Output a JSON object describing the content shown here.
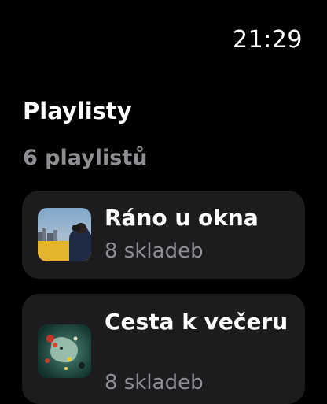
{
  "status": {
    "time": "21:29"
  },
  "header": {
    "title": "Playlisty",
    "count_label": "6 playlistů"
  },
  "playlists": [
    {
      "title": "Ráno u okna",
      "tracks": "8 skladeb",
      "artwork": "person-at-window-artwork"
    },
    {
      "title": "Cesta k večeru",
      "tracks": "8 skladeb",
      "artwork": "abstract-paint-splash-artwork"
    }
  ],
  "colors": {
    "background": "#000000",
    "card": "#1c1c1e",
    "secondary_text": "#8e8e93",
    "primary_text": "#ffffff"
  }
}
